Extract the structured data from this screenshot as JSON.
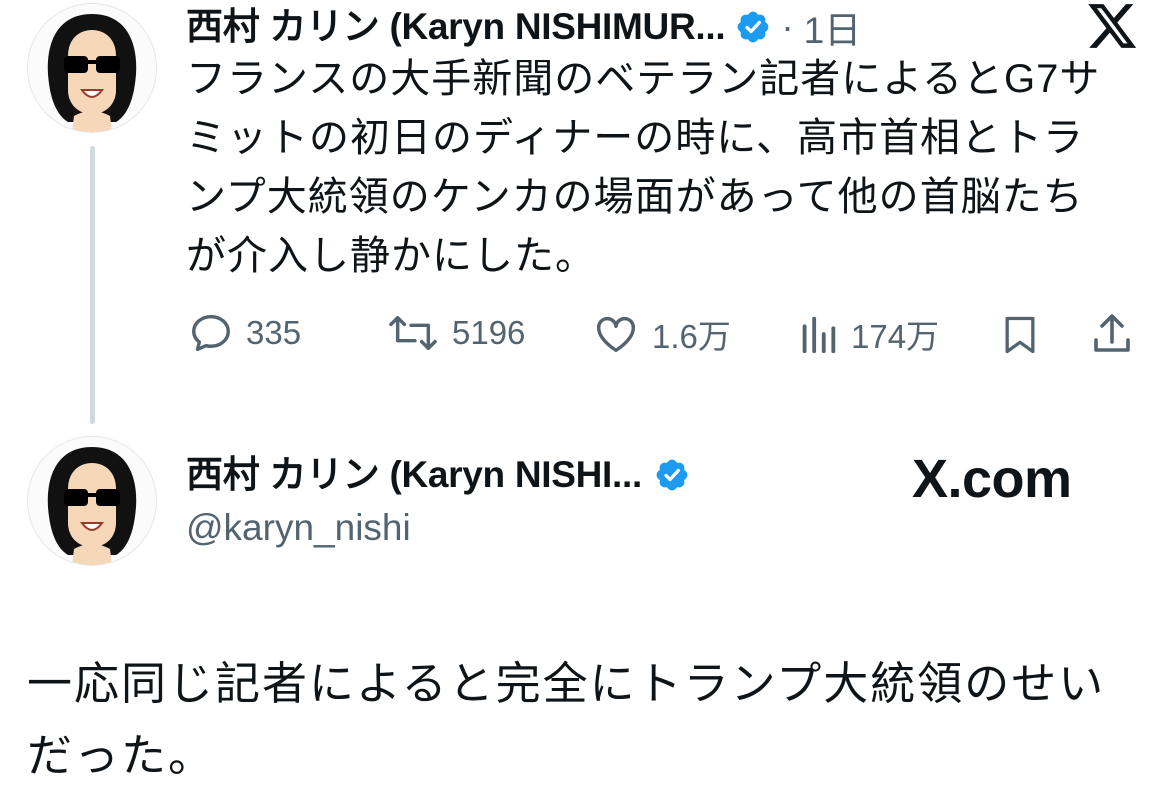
{
  "tweet": {
    "display_name": "西村 カリン (Karyn NISHIMUR...",
    "separator": "·",
    "time": "1日",
    "text_lines": [
      "フランスの大手新聞のベテラン記者によるとG7サ",
      "ミットの初日のディナーの時に、高市首相とトラ",
      "ンプ大統領のケンカの場面があって他の首脳たち",
      "が介入し静かにした。"
    ],
    "actions": {
      "replies": "335",
      "reposts": "5196",
      "likes": "1.6万",
      "views": "174万"
    }
  },
  "card": {
    "display_name": "西村 カリン (Karyn NISHI...",
    "handle": "@karyn_nishi",
    "site": "X.com"
  },
  "reply": {
    "text_lines": [
      "一応同じ記者によると完全にトランプ大統領のせい",
      "だった。"
    ]
  },
  "colors": {
    "verified_blue": "#1d9bf0",
    "meta_gray": "#536471",
    "text": "#0f1419",
    "thread_line": "#cfd9de"
  }
}
